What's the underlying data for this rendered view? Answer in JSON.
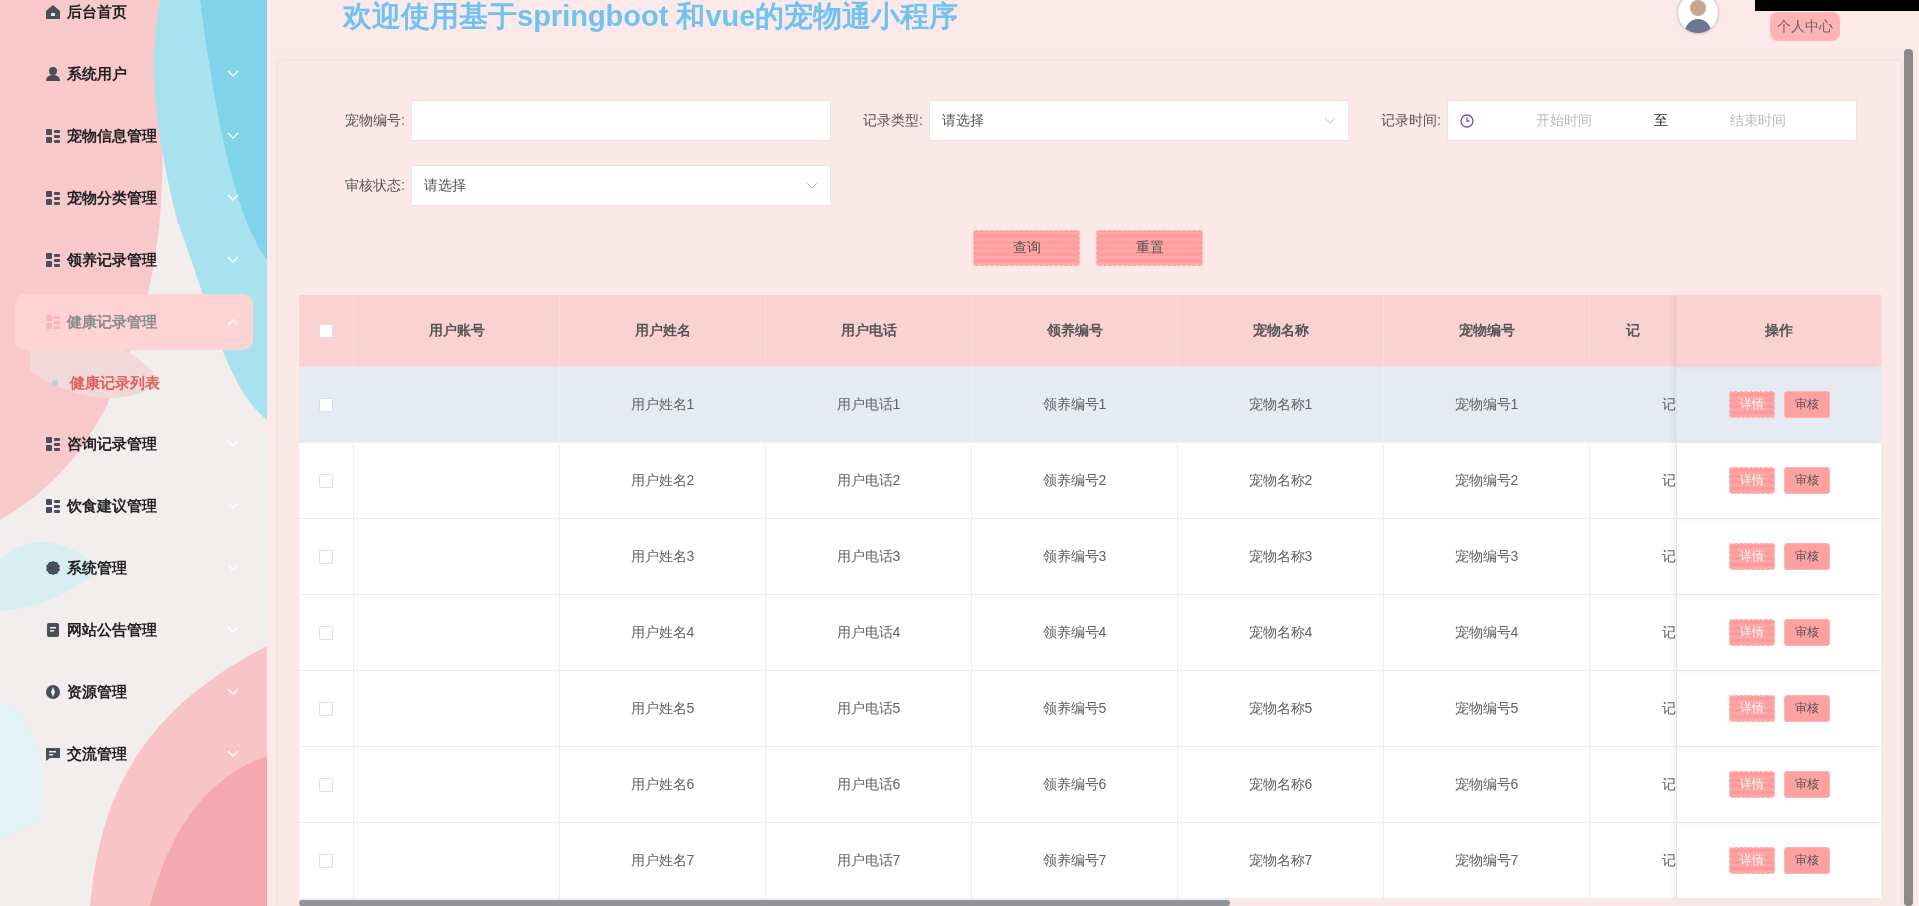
{
  "sidebar": {
    "items": [
      {
        "label": "后台首页"
      },
      {
        "label": "系统用户",
        "expanded": false
      },
      {
        "label": "宠物信息管理",
        "expanded": false
      },
      {
        "label": "宠物分类管理",
        "expanded": false
      },
      {
        "label": "领养记录管理",
        "expanded": false
      },
      {
        "label": "健康记录管理",
        "expanded": true,
        "children": [
          {
            "label": "健康记录列表",
            "selected": true
          }
        ]
      },
      {
        "label": "咨询记录管理",
        "expanded": false
      },
      {
        "label": "饮食建议管理",
        "expanded": false
      },
      {
        "label": "系统管理",
        "expanded": false
      },
      {
        "label": "网站公告管理",
        "expanded": false
      },
      {
        "label": "资源管理",
        "expanded": false
      },
      {
        "label": "交流管理",
        "expanded": false
      }
    ]
  },
  "header": {
    "title": "欢迎使用基于springboot 和vue的宠物通小程序",
    "profile_button": "个人中心"
  },
  "filters": [
    {
      "kind": "text",
      "label": "宠物编号:"
    },
    {
      "kind": "select",
      "label": "记录类型:",
      "placeholder": "请选择"
    },
    {
      "kind": "daterange",
      "label": "记录时间:",
      "start_placeholder": "开始时间",
      "separator": "至",
      "end_placeholder": "结束时间"
    },
    {
      "kind": "select",
      "label": "审核状态:",
      "placeholder": "请选择"
    }
  ],
  "buttons": [
    "查询",
    "重置"
  ],
  "table": {
    "select_all": {
      "checked": false
    },
    "columns": [
      "用户账号",
      "用户姓名",
      "用户电话",
      "领养编号",
      "宠物名称",
      "宠物编号",
      "记",
      "操作"
    ],
    "rows": [
      {
        "checked": false,
        "hovered": true,
        "cells": [
          null,
          "用户姓名1",
          "用户电话1",
          "领养编号1",
          "宠物名称1",
          "宠物编号1",
          "记"
        ],
        "actions": [
          {
            "label": "详情",
            "kind": "primary"
          },
          {
            "label": "审核",
            "kind": "secondary"
          }
        ]
      },
      {
        "checked": false,
        "hovered": false,
        "cells": [
          null,
          "用户姓名2",
          "用户电话2",
          "领养编号2",
          "宠物名称2",
          "宠物编号2",
          "记"
        ],
        "actions": [
          {
            "label": "详情",
            "kind": "primary"
          },
          {
            "label": "审核",
            "kind": "secondary"
          }
        ]
      },
      {
        "checked": false,
        "hovered": false,
        "cells": [
          null,
          "用户姓名3",
          "用户电话3",
          "领养编号3",
          "宠物名称3",
          "宠物编号3",
          "记"
        ],
        "actions": [
          {
            "label": "详情",
            "kind": "primary"
          },
          {
            "label": "审核",
            "kind": "secondary"
          }
        ]
      },
      {
        "checked": false,
        "hovered": false,
        "cells": [
          null,
          "用户姓名4",
          "用户电话4",
          "领养编号4",
          "宠物名称4",
          "宠物编号4",
          "记"
        ],
        "actions": [
          {
            "label": "详情",
            "kind": "primary"
          },
          {
            "label": "审核",
            "kind": "secondary"
          }
        ]
      },
      {
        "checked": false,
        "hovered": false,
        "cells": [
          null,
          "用户姓名5",
          "用户电话5",
          "领养编号5",
          "宠物名称5",
          "宠物编号5",
          "记"
        ],
        "actions": [
          {
            "label": "详情",
            "kind": "primary"
          },
          {
            "label": "审核",
            "kind": "secondary"
          }
        ]
      },
      {
        "checked": false,
        "hovered": false,
        "cells": [
          null,
          "用户姓名6",
          "用户电话6",
          "领养编号6",
          "宠物名称6",
          "宠物编号6",
          "记"
        ],
        "actions": [
          {
            "label": "详情",
            "kind": "primary"
          },
          {
            "label": "审核",
            "kind": "secondary"
          }
        ]
      },
      {
        "checked": false,
        "hovered": false,
        "cells": [
          null,
          "用户姓名7",
          "用户电话7",
          "领养编号7",
          "宠物名称7",
          "宠物编号7",
          "记"
        ],
        "actions": [
          {
            "label": "详情",
            "kind": "primary"
          },
          {
            "label": "审核",
            "kind": "secondary"
          }
        ]
      }
    ]
  }
}
